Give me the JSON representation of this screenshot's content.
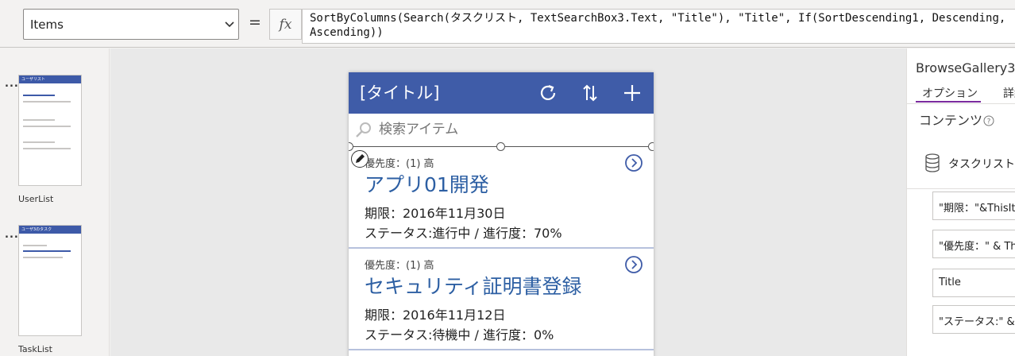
{
  "formula": {
    "property": "Items",
    "equals": "=",
    "fx": "fx",
    "text": "SortByColumns(Search(タスクリスト, TextSearchBox3.Text, \"Title\"), \"Title\", If(SortDescending1, Descending,\nAscending))"
  },
  "screens": [
    {
      "menu": "...",
      "name": "UserList",
      "thumb_title": "ユーザリスト",
      "thumb_lines": [
        "ユーザ3",
        "ユーザ2",
        "ユーザ1"
      ]
    },
    {
      "menu": "...",
      "name": "TaskList",
      "thumb_title": "ユーザ3のタスク",
      "thumb_lines": [
        "セキュリティ証明書登録"
      ]
    }
  ],
  "app": {
    "title": "[タイトル]",
    "icons": {
      "refresh": "refresh-icon",
      "sort": "sort-icon",
      "add": "add-icon"
    },
    "search_placeholder": "検索アイテム",
    "items": [
      {
        "priority": "優先度：(1) 高",
        "title": "アプリ01開発",
        "due": "期限：2016年11月30日",
        "status": "ステータス:進行中 / 進行度：70%"
      },
      {
        "priority": "優先度：(1) 高",
        "title": "セキュリティ証明書登録",
        "due": "期限：2016年11月12日",
        "status": "ステータス:待機中 / 進行度：0%"
      }
    ]
  },
  "properties": {
    "control_name": "BrowseGallery3",
    "tabs": [
      "オプション",
      "詳細"
    ],
    "content_label": "コンテンツ",
    "data_source": "タスクリスト",
    "fields": [
      "\"期限：\"&ThisIte",
      "\"優先度：\" & Thi",
      "Title",
      "\"ステータス:\" & "
    ]
  },
  "colors": {
    "header": "#3f5ca8",
    "title_text": "#2d5fa3",
    "tab_accent": "#7a2b9e"
  }
}
